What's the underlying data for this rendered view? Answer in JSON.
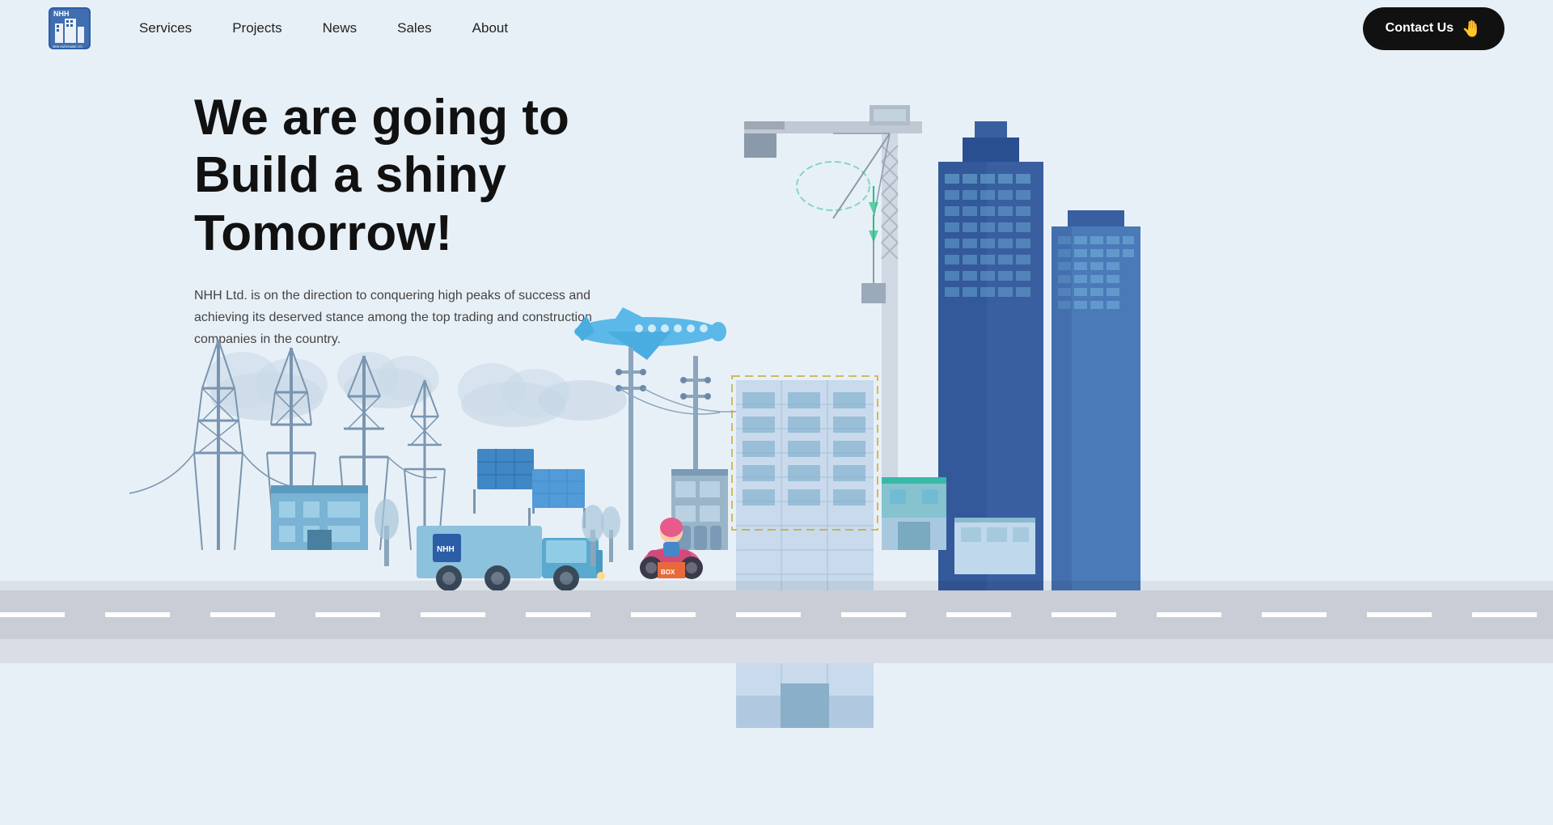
{
  "navbar": {
    "logo_text": "NHH",
    "logo_subtitle": "NEW HAFIZHABIE LTD",
    "nav_items": [
      {
        "label": "Services",
        "id": "services"
      },
      {
        "label": "Projects",
        "id": "projects"
      },
      {
        "label": "News",
        "id": "news"
      },
      {
        "label": "Sales",
        "id": "sales"
      },
      {
        "label": "About",
        "id": "about"
      }
    ],
    "contact_label": "Contact Us"
  },
  "hero": {
    "title": "We are going to Build a shiny Tomorrow!",
    "subtitle": "NHH Ltd. is on the direction to conquering high peaks of success and achieving its deserved stance among the top trading and construction companies in the country."
  },
  "colors": {
    "bg": "#e8f0f7",
    "dark": "#111111",
    "blue_primary": "#2b6cb0",
    "blue_light": "#63b3ed",
    "blue_building": "#3a5fa0",
    "accent_teal": "#38b2ac",
    "road": "#c8cdd6"
  }
}
